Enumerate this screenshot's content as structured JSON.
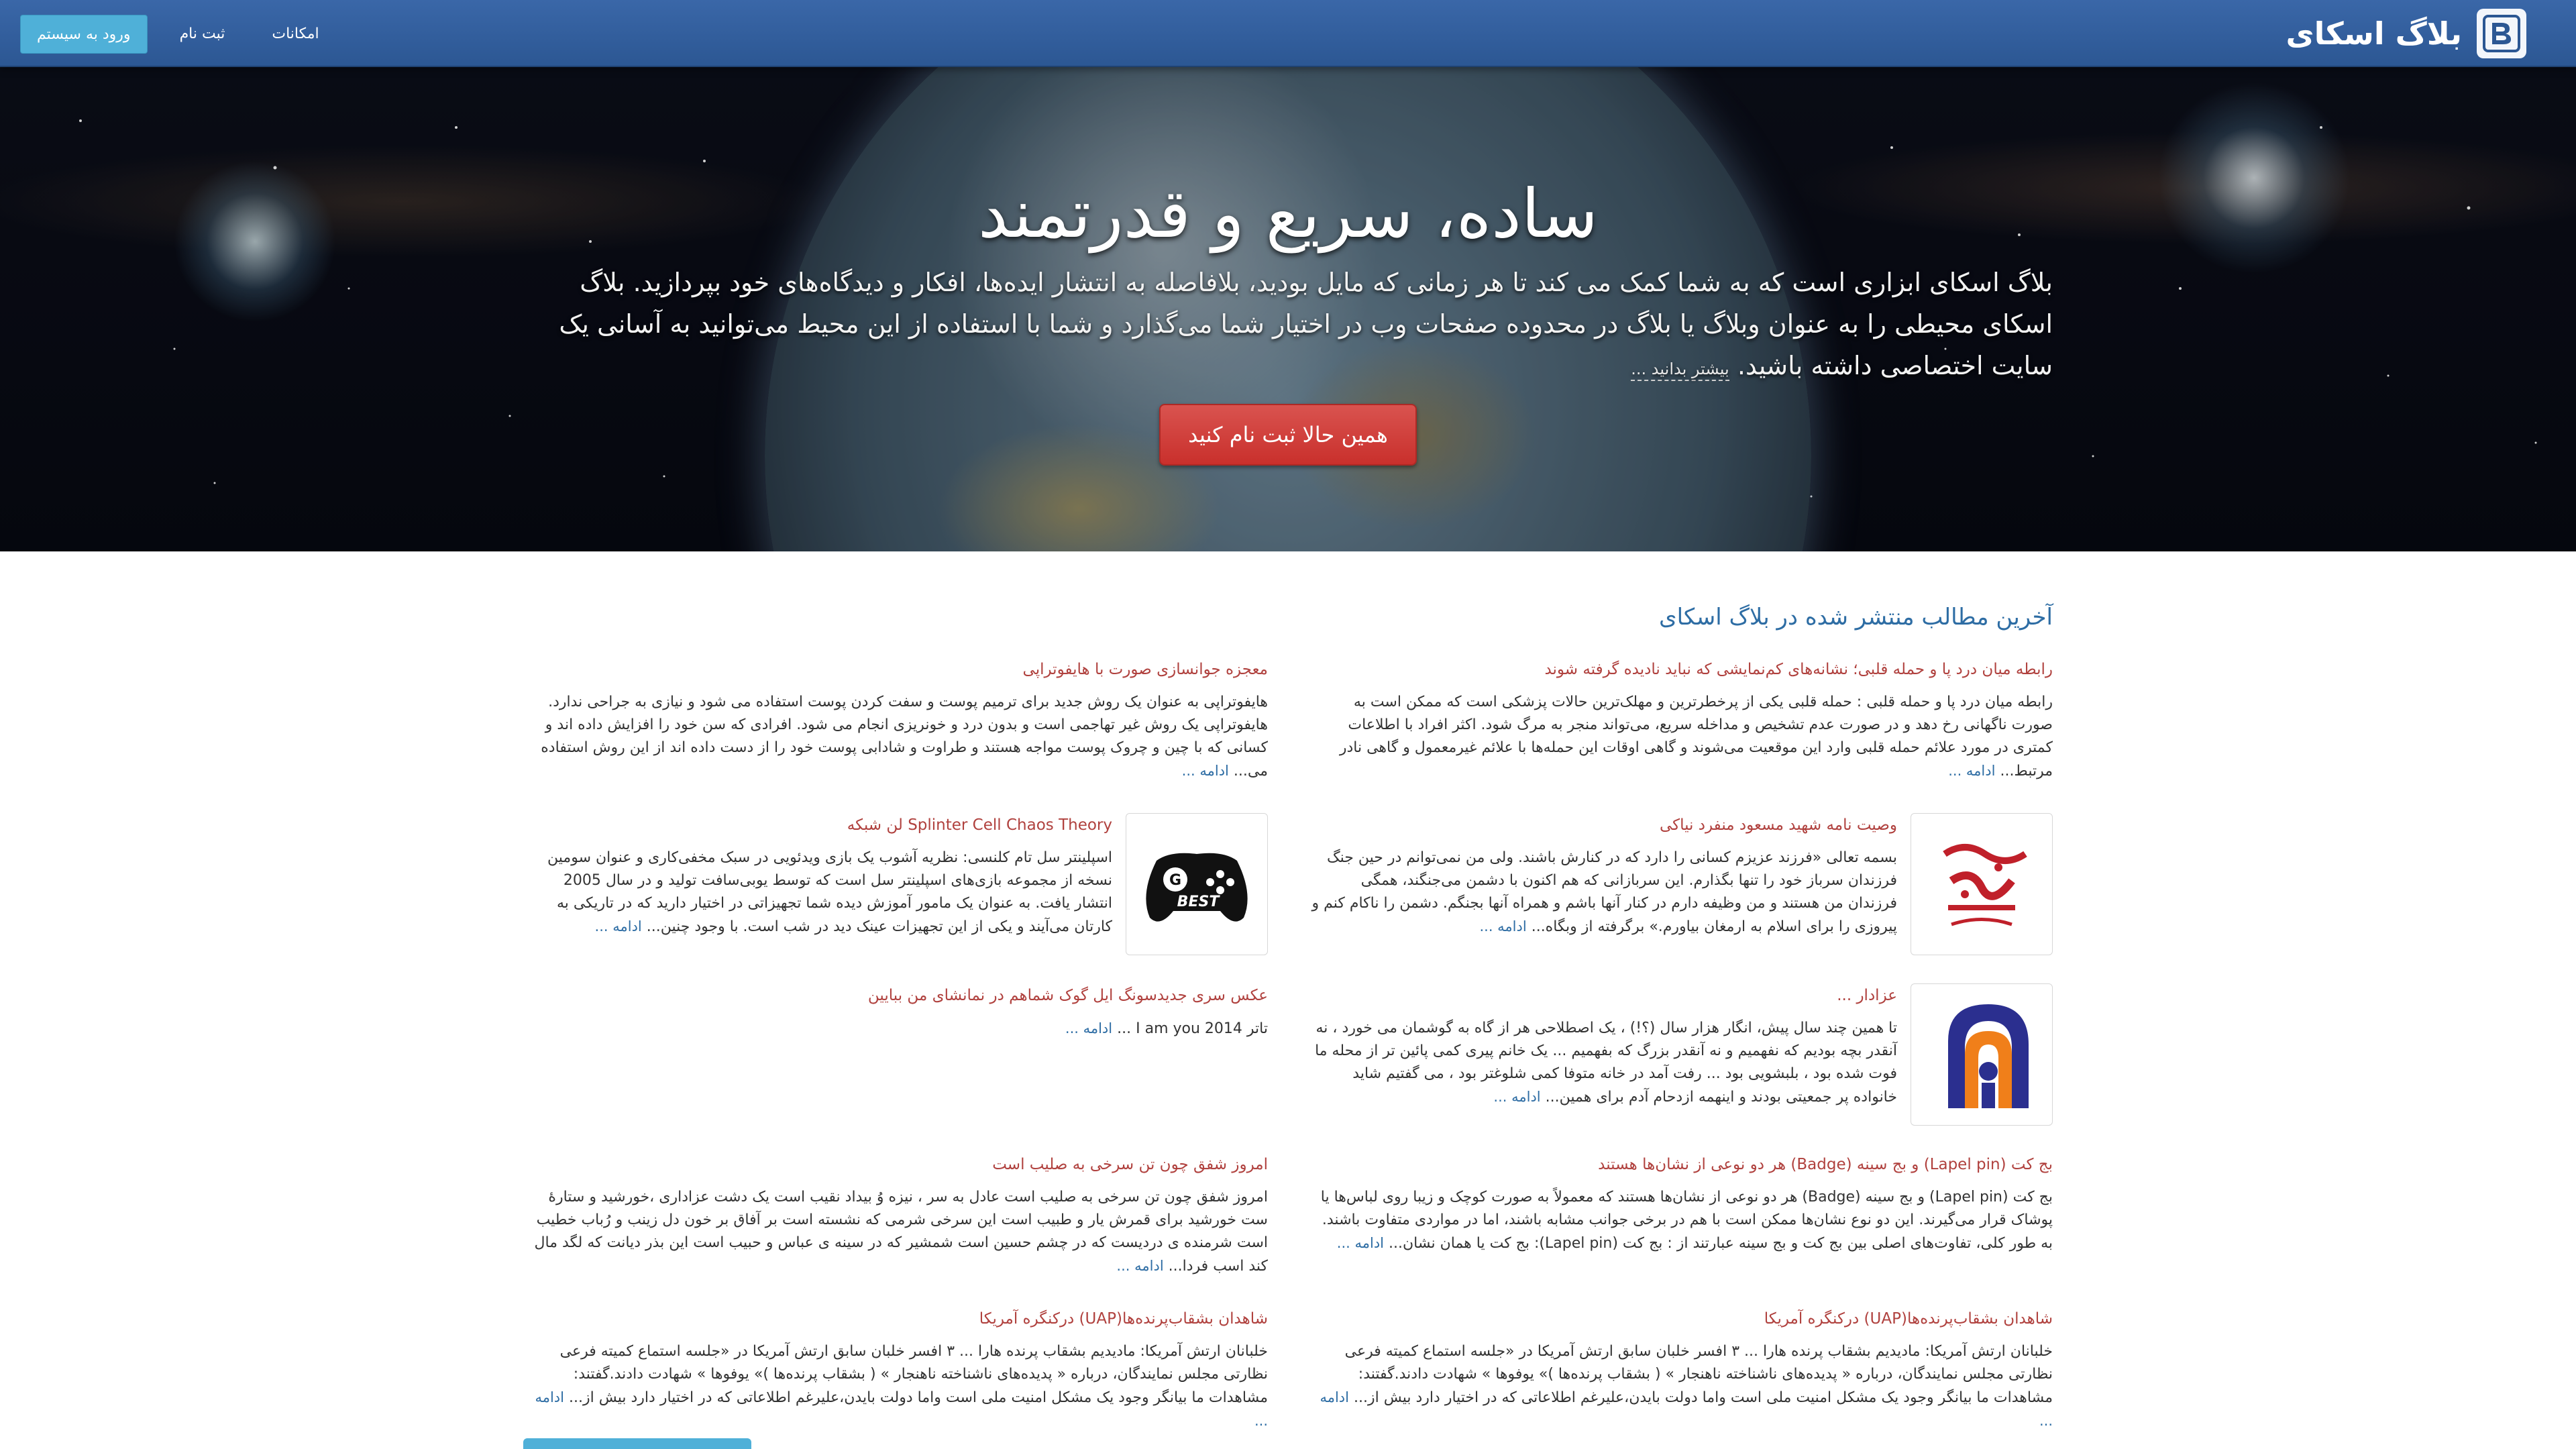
{
  "nav": {
    "brand": "بلاگ اسکای",
    "links": [
      "امکانات",
      "ثبت نام"
    ],
    "login": "ورود به سیستم"
  },
  "hero": {
    "title": "ساده، سریع و قدرتمند",
    "description": "بلاگ اسکای ابزاری است که به شما کمک می کند تا هر زمانی که مایل بودید، بلافاصله به انتشار ایده‌ها، افکار و دیدگاه‌های خود بپردازید. بلاگ اسکای محیطی را به عنوان وبلاگ یا بلاگ در محدوده صفحات وب در اختیار شما می‌گذارد و شما با استفاده از این محیط می‌توانید به آسانی یک سایت اختصاصی داشته باشید.",
    "more": "بیشتر بدانید ...",
    "cta": "همین حالا ثبت نام کنید"
  },
  "section": {
    "title": "آخرین مطالب منتشر شده در بلاگ اسکای"
  },
  "more_label": "ادامه ...",
  "posts": [
    {
      "title": "رابطه میان درد پا و حمله قلبی؛ نشانه‌های کم‌نمایشی که نباید نادیده گرفته شوند",
      "body": "رابطه میان درد پا و حمله قلبی : حمله قلبی یکی از پرخطرترین و مهلک‌ترین حالات پزشکی است که ممکن است به صورت ناگهانی رخ دهد و در صورت عدم تشخیص و مداخله سریع، می‌تواند منجر به مرگ شود. اکثر افراد با اطلاعات کمتری در مورد علائم حمله قلبی وارد این موقعیت می‌شوند و گاهی اوقات این حمله‌ها با علائم غیرمعمول و گاهی نادر مرتبط..."
    },
    {
      "title": "معجزه جوانسازی صورت با هایفوتراپی",
      "body": "هایفوتراپی به عنوان یک روش جدید برای ترمیم پوست و سفت کردن پوست استفاده می شود و نیازی به جراحی ندارد. هایفوتراپی یک روش غیر تهاجمی است و بدون درد و خونریزی انجام می شود. افرادی که سن خود را افزایش داده اند و کسانی که با چین و چروک پوست مواجه هستند و طراوت و شادابی پوست خود را از دست داده اند از این روش استفاده می..."
    },
    {
      "title": "وصیت نامه شهید مسعود منفرد نیاکی",
      "body": "بسمه تعالی «فرزند عزیزم کسانی را دارد که در کنارش باشند. ولی من نمی‌توانم در حین جنگ فرزندان سرباز خود را تنها بگذارم. این سربازانی که هم اکنون با دشمن می‌جنگند، همگی فرزندان من هستند و من وظیفه دارم در کنار آنها باشم و همراه آنها بجنگم. دشمن را ناکام کنم و پیروزی را برای اسلام به ارمغان بیاورم.» برگرفته از وبگاه..."
    },
    {
      "title": "Splinter Cell Chaos Theory لن شبکه",
      "body": "اسپلینتر سل تام کلنسی: نظریه آشوب یک بازی ویدئویی در سبک مخفی‌کاری و عنوان سومین نسخه از مجموعه بازی‌های اسپلینتر سل است که توسط یوبی‌سافت تولید و در سال 2005 انتشار یافت. به عنوان یک مامور آموزش دیده شما تجهیزاتی در اختیار دارید که در تاریکی به کارتان می‌آیند و یکی از این تجهیزات عینک دید در شب است. با وجود چنین..."
    },
    {
      "title": "عزادار ...",
      "body": "تا همین چند سال پیش، انگار هزار سال (؟!) ، یک اصطلاحی هر از گاه به گوشمان می خورد ، نه آنقدر بچه بودیم که نفهمیم و نه آنقدر بزرگ که بفهمیم ... یک خانم پیری کمی پائین تر از محله ما فوت شده بود ، بلبشویی بود ... رفت آمد در خانه متوفا کمی شلوغتر بود ، می گفتیم شاید خانواده پر جمعیتی بودند و اینهمه ازدحام آدم برای همین..."
    },
    {
      "title": "عکس سری جدیدسونگ ایل گوک شماهم در نمانشای من ببایین",
      "body": "تاتر I am you 2014 ..."
    },
    {
      "title": "بج کت (Lapel pin) و بج سینه (Badge) هر دو نوعی از نشان‌ها هستند",
      "body": "بج کت (Lapel pin) و بج سینه (Badge) هر دو نوعی از نشان‌ها هستند که معمولاً به صورت کوچک و زیبا روی لباس‌ها یا پوشاک قرار می‌گیرند. این دو نوع نشان‌ها ممکن است با هم در برخی جوانب مشابه باشند، اما در مواردی متفاوت باشند. به طور کلی، تفاوت‌های اصلی بین بج کت و بج سینه عبارتند از : بج کت (Lapel pin): بج کت یا همان نشان..."
    },
    {
      "title": "امروز شفق چون تن سرخی به صلیب است",
      "body": "امروز شفق چون تن سرخی به صلیب است عادل به سر ، نیزه وُ بیداد نقیب است یک دشت عزاداری ،خورشید و ستارهٔ ست خورشید برای قمرش یار و طبیب است این سرخی شرمی که نشسته است بر آفاق بر خون دل زینب و رُباب خطیب است شرمنده ی دردیست که در چشم حسین است شمشیر که در سینه ی عباس و حبیب است این بذر دیانت که لگد مال کند اسب فردا..."
    },
    {
      "title": "شاهدان بشقاب‌پرنده‌ها(UAP) درکنگره آمریکا",
      "body": "خلبانان ارتش آمریکا: مادیدیم بشقاب پرنده هارا ... ۳ افسر خلبان سابق ارتش آمریکا در «جلسه استماع کمیته فرعی نظارتی مجلس نمایندگان، درباره « پدیده‌های ناشناخته ناهنجار » ( بشقاب پرنده‌ها )» یوفوها » شهادت دادند.گفتند: مشاهدات ما بیانگر وجود یک مشکل امنیت ملی است واما دولت بایدن،علیرغم اطلاعاتی که در اختیار دارد بیش از..."
    },
    {
      "title": "شاهدان بشقاب‌پرنده‌ها(UAP) درکنگره آمریکا",
      "body": "خلبانان ارتش آمریکا: مادیدیم بشقاب پرنده هارا ... ۳ افسر خلبان سابق ارتش آمریکا در «جلسه استماع کمیته فرعی نظارتی مجلس نمایندگان، درباره « پدیده‌های ناشناخته ناهنجار » ( بشقاب پرنده‌ها )» یوفوها » شهادت دادند.گفتند: مشاهدات ما بیانگر وجود یک مشکل امنیت ملی است واما دولت بایدن،علیرغم اطلاعاتی که در اختیار دارد بیش از..."
    }
  ],
  "images": {
    "post2": "calligraphy-logo",
    "post3": "gamepad-icon",
    "post4": "orange-blue-logo",
    "gamepad_label": "BEST"
  },
  "colors": {
    "nav": "#2f5c9a",
    "login_button": "#4fb0d8",
    "cta": "#d9534f",
    "post_title": "#b0413e",
    "link": "#2e6da4"
  }
}
